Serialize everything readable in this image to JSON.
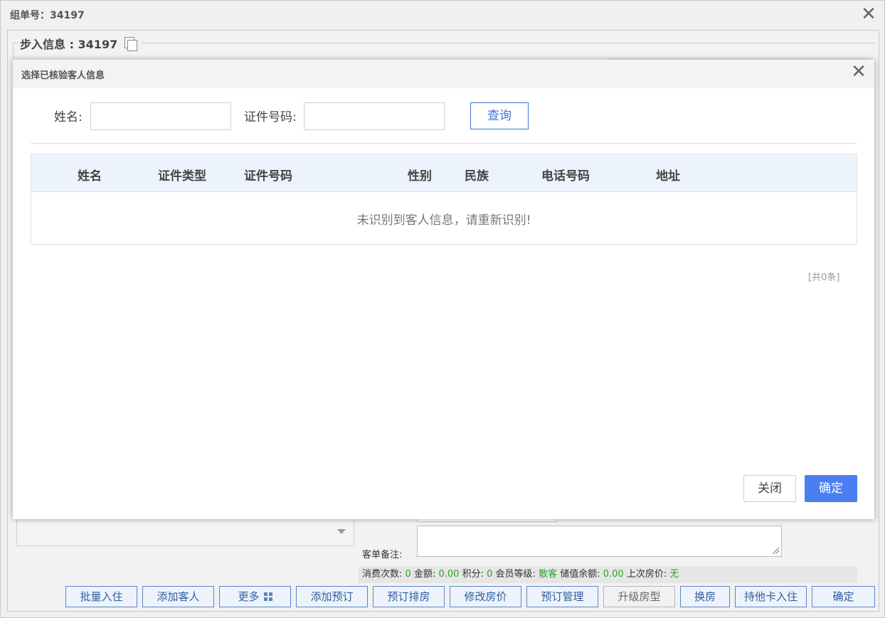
{
  "back_window": {
    "title": "组单号：34197",
    "step_info": "步入信息 : 34197",
    "remark_label": "客单备注:",
    "stats": {
      "visits_label": "消费次数:",
      "visits": "0",
      "amount_label": "金额:",
      "amount": "0.00",
      "points_label": "积分:",
      "points": "0",
      "level_label": "会员等级:",
      "level": "散客",
      "balance_label": "储值余额:",
      "balance": "0.00",
      "last_price_label": "上次房价:",
      "last_price": "无"
    },
    "buttons": [
      {
        "label": "批量入住"
      },
      {
        "label": "添加客人"
      },
      {
        "label": "更多"
      },
      {
        "label": "添加预订"
      },
      {
        "label": "预订排房"
      },
      {
        "label": "修改房价"
      },
      {
        "label": "预订管理"
      },
      {
        "label": "升级房型"
      },
      {
        "label": "换房"
      },
      {
        "label": "持他卡入住"
      },
      {
        "label": "确定"
      }
    ]
  },
  "modal": {
    "title": "选择已核验客人信息",
    "search": {
      "name_label": "姓名:",
      "name_value": "",
      "id_label": "证件号码:",
      "id_value": "",
      "query_button": "查询"
    },
    "table": {
      "columns": [
        "姓名",
        "证件类型",
        "证件号码",
        "性别",
        "民族",
        "电话号码",
        "地址"
      ],
      "rows": [],
      "empty_message": "未识别到客人信息，请重新识别!"
    },
    "total": "[共0条]",
    "close_button": "关闭",
    "ok_button": "确定"
  },
  "colors": {
    "primary": "#4a7ff0",
    "link_blue": "#3c74d6",
    "green_value": "#2aa12a"
  }
}
